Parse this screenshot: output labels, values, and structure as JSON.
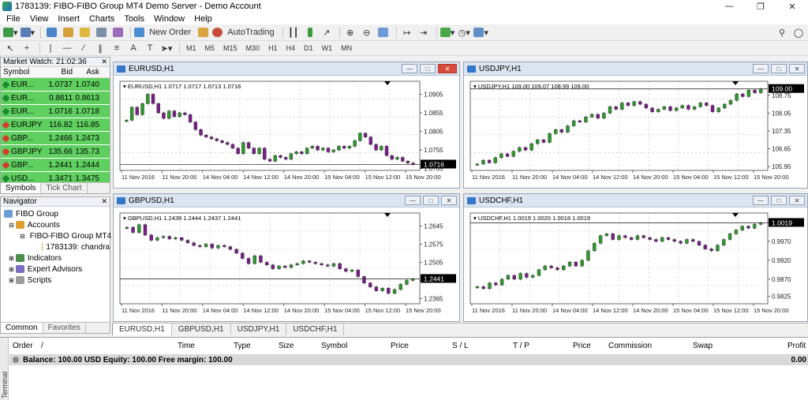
{
  "window": {
    "title": "1783139: FIBO-FIBO Group MT4 Demo Server - Demo Account"
  },
  "menu": [
    "File",
    "View",
    "Insert",
    "Charts",
    "Tools",
    "Window",
    "Help"
  ],
  "toolbar": {
    "new_order_label": "New Order",
    "autotrading_label": "AutoTrading",
    "timeframes": [
      "M1",
      "M5",
      "M15",
      "M30",
      "H1",
      "H4",
      "D1",
      "W1",
      "MN"
    ]
  },
  "market_watch": {
    "title": "Market Watch: 21:02:36",
    "columns": {
      "symbol": "Symbol",
      "bid": "Bid",
      "ask": "Ask"
    },
    "rows": [
      {
        "symbol": "EUR...",
        "bid": "1.0737",
        "ask": "1.0740",
        "dir": "up"
      },
      {
        "symbol": "EUR...",
        "bid": "0.8611",
        "ask": "0.8613",
        "dir": "up"
      },
      {
        "symbol": "EUR...",
        "bid": "1.0716",
        "ask": "1.0718",
        "dir": "up"
      },
      {
        "symbol": "EURJPY",
        "bid": "116.82",
        "ask": "116.85",
        "dir": "down"
      },
      {
        "symbol": "GBP...",
        "bid": "1.2466",
        "ask": "1.2473",
        "dir": "down"
      },
      {
        "symbol": "GBPJPY",
        "bid": "135.66",
        "ask": "135.73",
        "dir": "down"
      },
      {
        "symbol": "GBP...",
        "bid": "1.2441",
        "ask": "1.2444",
        "dir": "down"
      },
      {
        "symbol": "USD...",
        "bid": "1.3471",
        "ask": "1.3475",
        "dir": "up"
      }
    ],
    "tabs": [
      "Symbols",
      "Tick Chart"
    ]
  },
  "navigator": {
    "title": "Navigator",
    "items": [
      "FIBO Group",
      "Accounts",
      "FIBO-FIBO Group MT4",
      "1783139: chandra",
      "Indicators",
      "Expert Advisors",
      "Scripts"
    ],
    "tabs": [
      "Common",
      "Favorites"
    ]
  },
  "charts": [
    {
      "title": "EURUSD,H1",
      "info": "EURUSD,H1  1.0717 1.0717 1.0713 1.0716",
      "price_labels": [
        "1.0905",
        "1.0855",
        "1.0805",
        "1.0755",
        "1.0705"
      ],
      "current_price": "1.0716",
      "time_labels": [
        "11 Nov 2016",
        "11 Nov 20:00",
        "14 Nov 04:00",
        "14 Nov 12:00",
        "14 Nov 20:00",
        "15 Nov 04:00",
        "15 Nov 12:00",
        "15 Nov 20:00"
      ],
      "ymin": 1.07,
      "ymax": 1.094,
      "closes": [
        1.0835,
        1.087,
        1.085,
        1.088,
        1.0905,
        1.088,
        1.0855,
        1.084,
        1.086,
        1.0845,
        1.0855,
        1.085,
        1.083,
        1.081,
        1.0795,
        1.079,
        1.0785,
        1.078,
        1.0775,
        1.077,
        1.076,
        1.0745,
        1.0775,
        1.076,
        1.0745,
        1.076,
        1.073,
        1.0725,
        1.074,
        1.0735,
        1.073,
        1.0745,
        1.075,
        1.0745,
        1.076,
        1.0765,
        1.0755,
        1.076,
        1.075,
        1.0755,
        1.0765,
        1.076,
        1.0765,
        1.078,
        1.08,
        1.079,
        1.077,
        1.0755,
        1.0765,
        1.074,
        1.073,
        1.0735,
        1.0725,
        1.072,
        1.0716
      ]
    },
    {
      "title": "USDJPY,H1",
      "info": "USDJPY,H1  109.00 109.07 108.99 109.00",
      "price_labels": [
        "108.75",
        "108.05",
        "107.35",
        "106.65",
        "105.95"
      ],
      "current_price": "109.00",
      "time_labels": [
        "11 Nov 2016",
        "11 Nov 20:00",
        "14 Nov 04:00",
        "14 Nov 12:00",
        "14 Nov 20:00",
        "15 Nov 04:00",
        "15 Nov 12:00",
        "15 Nov 20:00"
      ],
      "ymin": 105.8,
      "ymax": 109.3,
      "closes": [
        106.05,
        106.2,
        106.1,
        106.3,
        106.45,
        106.35,
        106.55,
        106.7,
        106.6,
        106.85,
        107.0,
        106.9,
        107.25,
        107.4,
        107.3,
        107.55,
        107.75,
        107.7,
        107.9,
        108.0,
        107.85,
        108.05,
        108.3,
        108.2,
        108.45,
        108.35,
        108.5,
        108.4,
        108.25,
        108.1,
        108.2,
        108.3,
        108.15,
        108.25,
        108.35,
        108.2,
        108.3,
        108.45,
        108.35,
        108.1,
        108.25,
        108.4,
        108.55,
        108.8,
        108.7,
        108.95,
        108.85,
        109.0
      ]
    },
    {
      "title": "GBPUSD,H1",
      "info": "GBPUSD,H1  1.2439 1.2444 1.2437 1.2441",
      "price_labels": [
        "1.2645",
        "1.2575",
        "1.2505",
        "1.2435",
        "1.2365"
      ],
      "current_price": "1.2441",
      "time_labels": [
        "11 Nov 2016",
        "11 Nov 20:00",
        "14 Nov 04:00",
        "14 Nov 12:00",
        "14 Nov 20:00",
        "15 Nov 04:00",
        "15 Nov 12:00",
        "15 Nov 20:00"
      ],
      "ymin": 1.2345,
      "ymax": 1.2695,
      "closes": [
        1.264,
        1.262,
        1.265,
        1.261,
        1.259,
        1.26,
        1.2605,
        1.2595,
        1.26,
        1.259,
        1.258,
        1.257,
        1.2565,
        1.2575,
        1.256,
        1.257,
        1.2565,
        1.2555,
        1.254,
        1.252,
        1.25,
        1.253,
        1.2505,
        1.2495,
        1.248,
        1.249,
        1.2485,
        1.2495,
        1.25,
        1.251,
        1.2505,
        1.25,
        1.2495,
        1.249,
        1.25,
        1.248,
        1.247,
        1.2475,
        1.245,
        1.2425,
        1.241,
        1.2395,
        1.2405,
        1.2385,
        1.24,
        1.242,
        1.2435,
        1.2441
      ]
    },
    {
      "title": "USDCHF,H1",
      "info": "USDCHF,H1  1.0019 1.0020 1.0018 1.0019",
      "price_labels": [
        "1.0019",
        "0.9970",
        "0.9920",
        "0.9870",
        "0.9825"
      ],
      "current_price": "1.0019",
      "time_labels": [
        "11 Nov 2016",
        "11 Nov 20:00",
        "14 Nov 04:00",
        "14 Nov 12:00",
        "14 Nov 20:00",
        "15 Nov 04:00",
        "15 Nov 12:00",
        "15 Nov 20:00"
      ],
      "ymin": 0.9805,
      "ymax": 1.0045,
      "closes": [
        0.985,
        0.9845,
        0.986,
        0.9855,
        0.987,
        0.988,
        0.987,
        0.9885,
        0.9875,
        0.988,
        0.9895,
        0.9905,
        0.99,
        0.9895,
        0.9905,
        0.9915,
        0.9905,
        0.992,
        0.9945,
        0.9965,
        0.9985,
        0.999,
        0.9975,
        0.9985,
        0.998,
        0.9975,
        0.9985,
        0.998,
        0.9975,
        0.997,
        0.998,
        0.9975,
        0.997,
        0.9965,
        0.9975,
        0.997,
        0.996,
        0.995,
        0.9945,
        0.996,
        0.9975,
        0.999,
        1.0,
        1.001,
        1.0005,
        1.0015,
        1.0019
      ]
    }
  ],
  "chart_tabs": [
    "EURUSD,H1",
    "GBPUSD,H1",
    "USDJPY,H1",
    "USDCHF,H1"
  ],
  "terminal": {
    "side_label": "Terminal",
    "columns": [
      "Order",
      "/",
      "Time",
      "Type",
      "Size",
      "Symbol",
      "Price",
      "S / L",
      "T / P",
      "Price",
      "Commission",
      "Swap",
      "Profit"
    ],
    "balance_text": "Balance: 100.00 USD  Equity: 100.00  Free margin: 100.00",
    "balance_value": "0.00"
  },
  "colors": {
    "bull_candle": "#2e9a2e",
    "bear_candle": "#7a1f8a",
    "watch_row": "#5fd05f"
  }
}
